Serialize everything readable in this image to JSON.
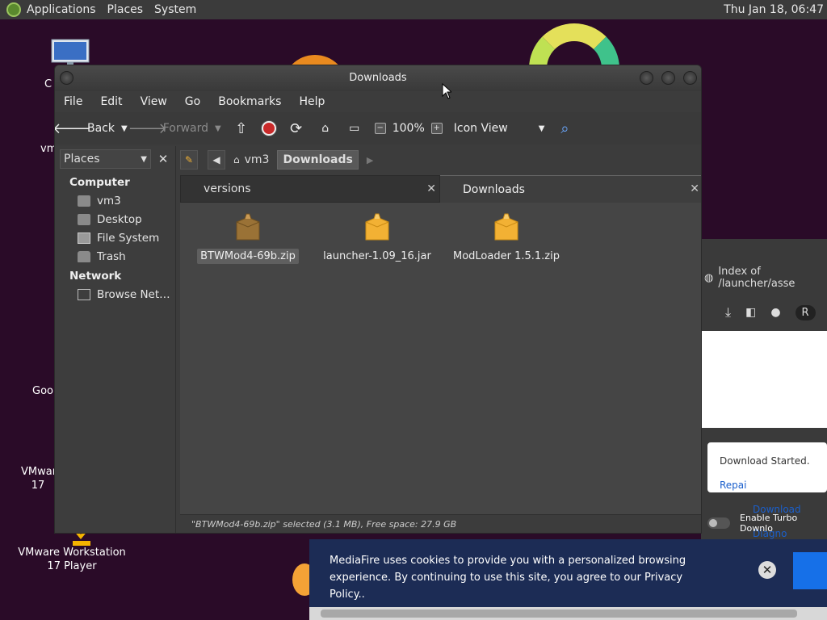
{
  "top_panel": {
    "menus": [
      "Applications",
      "Places",
      "System"
    ],
    "clock": "Thu Jan 18, 06:47"
  },
  "desktop": {
    "labels": {
      "computer_partial": "C",
      "vm_partial": "vm",
      "google_partial": "Goo",
      "vmware_partial_line1": "VMware",
      "vmware_partial_line2": "17",
      "vmware_player_line1": "VMware Workstation",
      "vmware_player_line2": "17 Player"
    }
  },
  "file_manager": {
    "title": "Downloads",
    "menus": [
      "File",
      "Edit",
      "View",
      "Go",
      "Bookmarks",
      "Help"
    ],
    "toolbar": {
      "back": "Back",
      "forward": "Forward",
      "zoom": "100%",
      "view_mode": "Icon View"
    },
    "side_panel": {
      "dropdown": "Places",
      "computer_header": "Computer",
      "computer_items": [
        "vm3",
        "Desktop",
        "File System",
        "Trash"
      ],
      "network_header": "Network",
      "network_items": [
        "Browse Net…"
      ]
    },
    "breadcrumbs": [
      "vm3",
      "Downloads"
    ],
    "tabs": [
      "versions",
      "Downloads"
    ],
    "files": [
      {
        "name": "BTWMod4-69b.zip",
        "selected": true
      },
      {
        "name": "launcher-1.09_16.jar",
        "selected": false
      },
      {
        "name": "ModLoader 1.5.1.zip",
        "selected": false
      }
    ],
    "status": "\"BTWMod4-69b.zip\" selected (3.1 MB), Free space: 27.9 GB"
  },
  "browser": {
    "address": "Index of /launcher/asse",
    "partial_button": "R",
    "notification": {
      "text": "Download Started. ",
      "link1": "Repai",
      "link2": "Download Diagno"
    },
    "turbo": "Enable Turbo Downlo"
  },
  "cookie_banner": {
    "text": "MediaFire uses cookies to provide you with a personalized browsing experience. By continuing to use this site, you agree to our Privacy Policy..",
    "close": "✕"
  },
  "colors": {
    "desktop_bg": "#2a0b28",
    "window_bg": "#3c3c3c",
    "content_bg": "#454545",
    "cookie_bg": "#1c2c55",
    "accent_blue": "#1670e8",
    "stop_red": "#c92a2a",
    "folder_orange": "#f2b134"
  }
}
